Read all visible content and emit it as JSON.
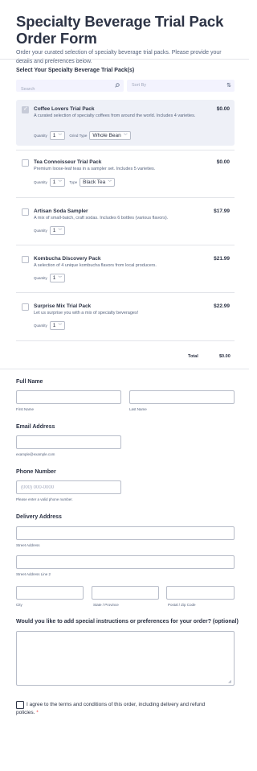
{
  "header": {
    "title": "Specialty Beverage Trial Pack Order Form",
    "subtitle": "Order your curated selection of specialty beverage trial packs. Please provide your details and preferences below."
  },
  "products_section": {
    "label": "Select Your Specialty Beverage Trial Pack(s)",
    "search_placeholder": "Search",
    "sort_label": "Sort By",
    "icons": {
      "search": "search-icon",
      "sort": "sort-icon"
    },
    "items": [
      {
        "name": "Coffee Lovers Trial Pack",
        "description": "A curated selection of specialty coffees from around the world. Includes 4 varieties.",
        "price": "$0.00",
        "checked": true,
        "quantity_label": "Quantity",
        "quantity_value": "1",
        "option_label": "Grind Type",
        "option_value": "Whole Bean"
      },
      {
        "name": "Tea Connoisseur Trial Pack",
        "description": "Premium loose-leaf teas in a sampler set. Includes 5 varieties.",
        "price": "$0.00",
        "checked": false,
        "quantity_label": "Quantity",
        "quantity_value": "1",
        "option_label": "Type",
        "option_value": "Black Tea"
      },
      {
        "name": "Artisan Soda Sampler",
        "description": "A mix of small-batch, craft sodas. Includes 6 bottles (various flavors).",
        "price": "$17.99",
        "checked": false,
        "quantity_label": "Quantity",
        "quantity_value": "1"
      },
      {
        "name": "Kombucha Discovery Pack",
        "description": "A selection of 4 unique kombucha flavors from local producers.",
        "price": "$21.99",
        "checked": false,
        "quantity_label": "Quantity",
        "quantity_value": "1"
      },
      {
        "name": "Surprise Mix Trial Pack",
        "description": "Let us surprise you with a mix of specialty beverages!",
        "price": "$22.99",
        "checked": false,
        "quantity_label": "Quantity",
        "quantity_value": "1"
      }
    ],
    "total_label": "Total",
    "total_value": "$0.00"
  },
  "full_name": {
    "label": "Full Name",
    "first_sublabel": "First Name",
    "last_sublabel": "Last Name"
  },
  "email": {
    "label": "Email Address",
    "sublabel": "example@example.com"
  },
  "phone": {
    "label": "Phone Number",
    "placeholder": "(000) 000-0000",
    "sublabel": "Please enter a valid phone number."
  },
  "address": {
    "label": "Delivery Address",
    "street_sublabel": "Street Address",
    "street2_sublabel": "Street Address Line 2",
    "city_sublabel": "City",
    "state_sublabel": "State / Province",
    "zip_sublabel": "Postal / Zip Code"
  },
  "instructions": {
    "label": "Would you like to add special instructions or preferences for your order? (optional)"
  },
  "agreement": {
    "text": "I agree to the terms and conditions of this order, including delivery and refund policies.",
    "required_mark": "*"
  },
  "colors": {
    "title": "#2c3345",
    "muted": "#57647e",
    "required": "#f23a3c",
    "selected_bg": "#eef0f7",
    "search_bg": "#f3f3fe"
  }
}
